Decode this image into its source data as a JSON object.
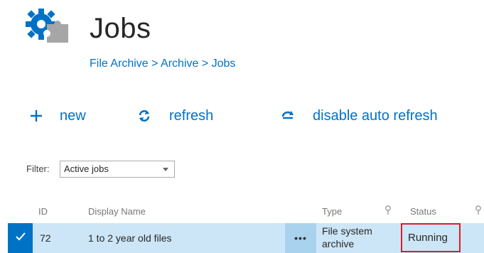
{
  "header": {
    "title": "Jobs",
    "breadcrumb": "File Archive > Archive > Jobs",
    "icon": "gear-puzzle-icon"
  },
  "toolbar": {
    "new_label": "new",
    "refresh_label": "refresh",
    "auto_refresh_label": "disable auto refresh"
  },
  "filter": {
    "label": "Filter:",
    "selected": "Active jobs"
  },
  "table": {
    "columns": {
      "id": "ID",
      "display_name": "Display Name",
      "type": "Type",
      "status": "Status"
    },
    "rows": [
      {
        "id": "72",
        "display_name": "1 to 2 year old files",
        "more": "•••",
        "type_line1": "File system",
        "type_line2": "archive",
        "status": "Running"
      }
    ]
  },
  "colors": {
    "accent": "#0072c6",
    "selected_row": "#cde6f7",
    "highlight_border": "#e01c24"
  }
}
